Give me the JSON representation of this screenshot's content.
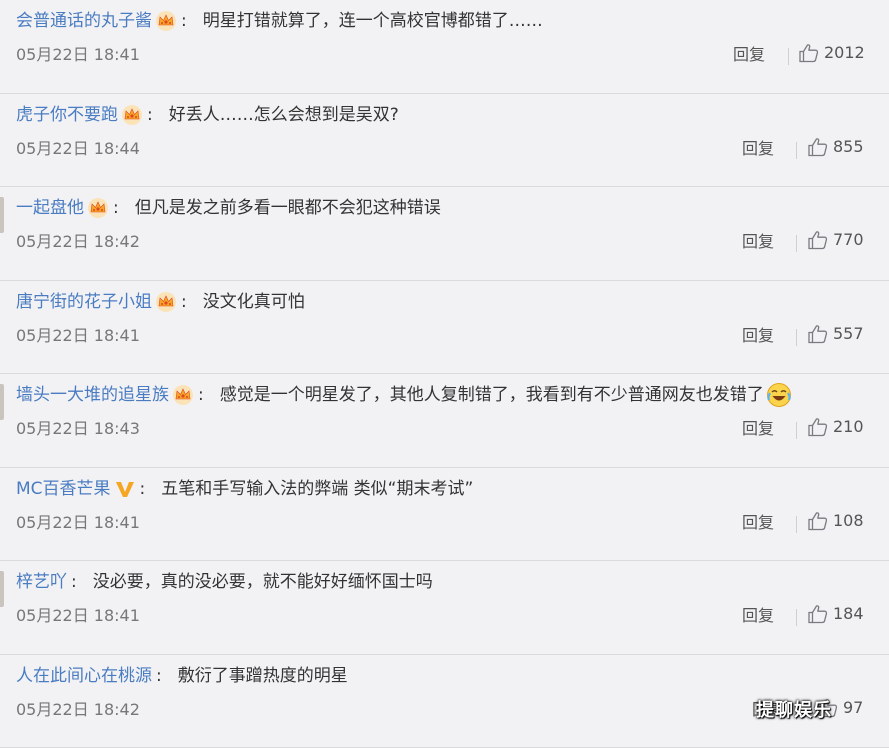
{
  "comments": [
    {
      "username": "会普通话的丸子酱",
      "badge": "crown",
      "text": "明星打错就算了，连一个高校官博都错了……",
      "time": "05月22日 18:41",
      "reply_label": "回复",
      "likes": "2012",
      "emoji": ""
    },
    {
      "username": "虎子你不要跑",
      "badge": "crown",
      "text": "好丢人……怎么会想到是吴双?",
      "time": "05月22日 18:44",
      "reply_label": "回复",
      "likes": "855",
      "emoji": ""
    },
    {
      "username": "一起盘他",
      "badge": "crown",
      "text": "但凡是发之前多看一眼都不会犯这种错误",
      "time": "05月22日 18:42",
      "reply_label": "回复",
      "likes": "770",
      "emoji": ""
    },
    {
      "username": "唐宁街的花子小姐",
      "badge": "crown",
      "text": "没文化真可怕",
      "time": "05月22日 18:41",
      "reply_label": "回复",
      "likes": "557",
      "emoji": ""
    },
    {
      "username": "墙头一大堆的追星族",
      "badge": "crown",
      "text": "感觉是一个明星发了，其他人复制错了，我看到有不少普通网友也发错了",
      "time": "05月22日 18:43",
      "reply_label": "回复",
      "likes": "210",
      "emoji": "laugh-cry"
    },
    {
      "username": "MC百香芒果",
      "badge": "v",
      "text": "五笔和手写输入法的弊端 类似“期末考试”",
      "time": "05月22日 18:41",
      "reply_label": "回复",
      "likes": "108",
      "emoji": ""
    },
    {
      "username": "梓艺吖",
      "badge": "",
      "text": "没必要，真的没必要，就不能好好缅怀国士吗",
      "time": "05月22日 18:41",
      "reply_label": "回复",
      "likes": "184",
      "emoji": ""
    },
    {
      "username": "人在此间心在桃源",
      "badge": "",
      "text": "敷衍了事蹭热度的明星",
      "time": "05月22日 18:42",
      "reply_label": "回复",
      "likes": "97",
      "emoji": ""
    }
  ],
  "watermark": "提聊娱乐",
  "colors": {
    "username": "#4a7cc1",
    "crown": "#f5a623",
    "v_badge": "#f5a623",
    "background": "#f2f2f5"
  }
}
